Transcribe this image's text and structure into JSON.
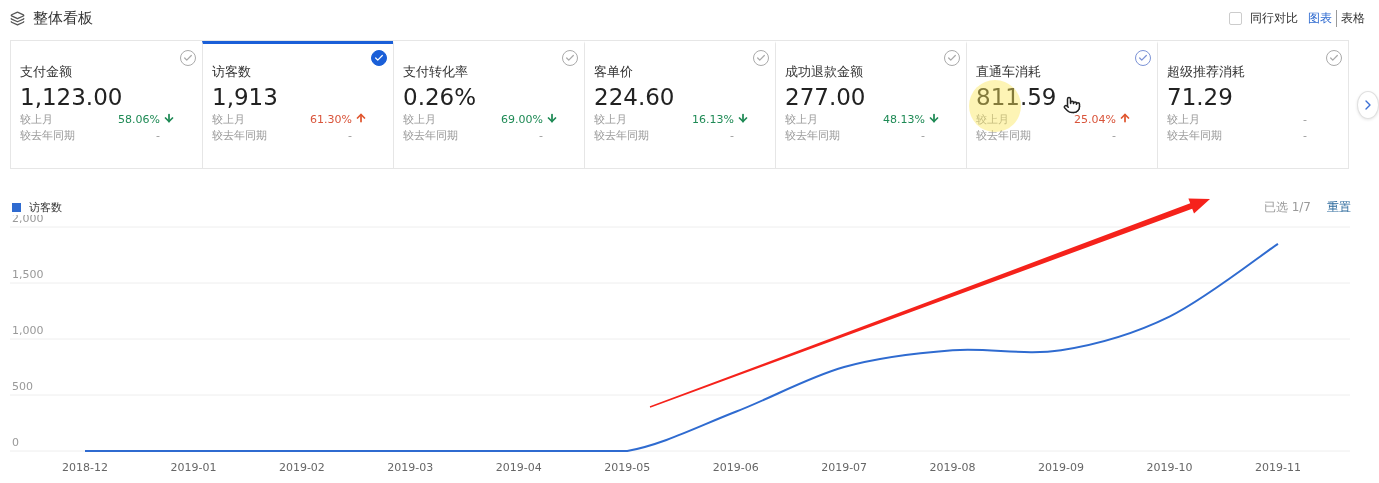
{
  "header": {
    "title": "整体看板",
    "peer_compare": {
      "label": "同行对比",
      "checked": false
    },
    "views": [
      {
        "label": "图表",
        "selected": true
      },
      {
        "label": "表格",
        "selected": false
      }
    ]
  },
  "cards": [
    {
      "label": "支付金额",
      "value": "1,123.00",
      "mom_label": "较上月",
      "mom": "58.06%",
      "kind": "down",
      "yoy_label": "较去年同期",
      "yoy": "-",
      "selected": false,
      "hovered": false
    },
    {
      "label": "访客数",
      "value": "1,913",
      "mom_label": "较上月",
      "mom": "61.30%",
      "kind": "up",
      "yoy_label": "较去年同期",
      "yoy": "-",
      "selected": true,
      "hovered": false
    },
    {
      "label": "支付转化率",
      "value": "0.26%",
      "mom_label": "较上月",
      "mom": "69.00%",
      "kind": "down",
      "yoy_label": "较去年同期",
      "yoy": "-",
      "selected": false,
      "hovered": false
    },
    {
      "label": "客单价",
      "value": "224.60",
      "mom_label": "较上月",
      "mom": "16.13%",
      "kind": "down",
      "yoy_label": "较去年同期",
      "yoy": "-",
      "selected": false,
      "hovered": false
    },
    {
      "label": "成功退款金额",
      "value": "277.00",
      "mom_label": "较上月",
      "mom": "48.13%",
      "kind": "down",
      "yoy_label": "较去年同期",
      "yoy": "-",
      "selected": false,
      "hovered": false
    },
    {
      "label": "直通车消耗",
      "value": "811.59",
      "mom_label": "较上月",
      "mom": "25.04%",
      "kind": "up",
      "yoy_label": "较去年同期",
      "yoy": "-",
      "selected": false,
      "hovered": true
    },
    {
      "label": "超级推荐消耗",
      "value": "71.29",
      "mom_label": "较上月",
      "mom": "-",
      "kind": "none",
      "yoy_label": "较去年同期",
      "yoy": "-",
      "selected": false,
      "hovered": false
    }
  ],
  "chart": {
    "selected_count": "已选 1/7",
    "reset": "重置",
    "chart_data": {
      "type": "line",
      "categories": [
        "2018-12",
        "2019-01",
        "2019-02",
        "2019-03",
        "2019-04",
        "2019-05",
        "2019-06",
        "2019-07",
        "2019-08",
        "2019-09",
        "2019-10",
        "2019-11"
      ],
      "series": [
        {
          "name": "访客数",
          "color": "#2f6bd0",
          "values": [
            0,
            0,
            0,
            0,
            0,
            0,
            350,
            750,
            900,
            900,
            1200,
            1850
          ]
        }
      ],
      "grid": true,
      "ylim": [
        0,
        2000
      ],
      "yticks": [
        {
          "value": 0,
          "label": "0"
        },
        {
          "value": 500,
          "label": "500"
        },
        {
          "value": 1000,
          "label": "1,000"
        },
        {
          "value": 1500,
          "label": "1,500"
        },
        {
          "value": 2000,
          "label": "2,000"
        }
      ]
    }
  }
}
